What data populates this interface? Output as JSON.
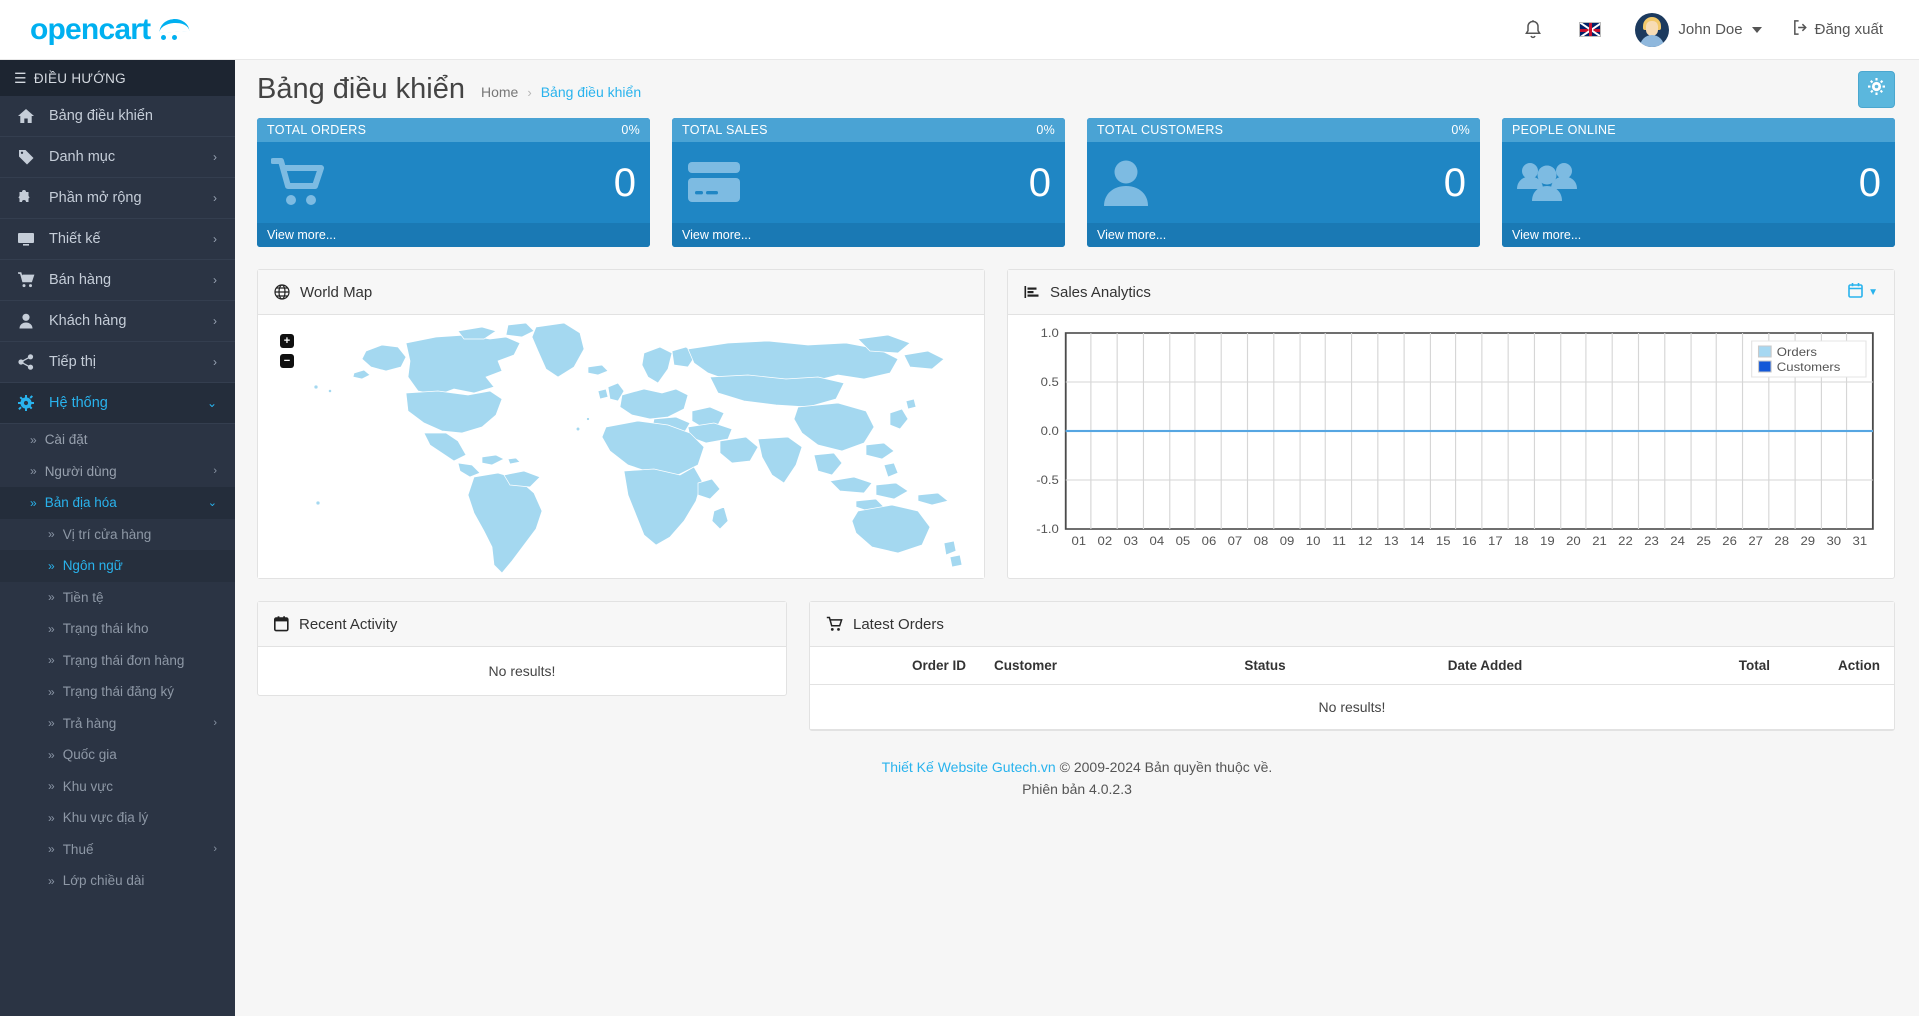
{
  "header": {
    "logo_text": "opencart",
    "bell_icon": "bell-icon",
    "language_flag": "uk-flag-icon",
    "user_name": "John Doe",
    "logout_label": "Đăng xuất"
  },
  "sidebar": {
    "nav_header": "ĐIỀU HƯỚNG",
    "items": [
      {
        "label": "Bảng điều khiển",
        "icon": "home-icon",
        "arrow": "",
        "state": ""
      },
      {
        "label": "Danh mục",
        "icon": "tag-icon",
        "arrow": "›",
        "state": ""
      },
      {
        "label": "Phần mở rộng",
        "icon": "puzzle-icon",
        "arrow": "›",
        "state": ""
      },
      {
        "label": "Thiết kế",
        "icon": "monitor-icon",
        "arrow": "›",
        "state": ""
      },
      {
        "label": "Bán hàng",
        "icon": "cart-icon",
        "arrow": "›",
        "state": ""
      },
      {
        "label": "Khách hàng",
        "icon": "user-icon",
        "arrow": "›",
        "state": ""
      },
      {
        "label": "Tiếp thị",
        "icon": "share-icon",
        "arrow": "›",
        "state": ""
      },
      {
        "label": "Hệ thống",
        "icon": "gear-icon",
        "arrow": "⌄",
        "state": "active"
      }
    ],
    "system_children": [
      {
        "label": "Cài đặt",
        "arrow": "",
        "state": ""
      },
      {
        "label": "Người dùng",
        "arrow": "›",
        "state": ""
      },
      {
        "label": "Bản địa hóa",
        "arrow": "⌄",
        "state": "open"
      }
    ],
    "localisation_children": [
      {
        "label": "Vị trí cửa hàng",
        "arrow": "",
        "state": ""
      },
      {
        "label": "Ngôn ngữ",
        "arrow": "",
        "state": "active"
      },
      {
        "label": "Tiền tệ",
        "arrow": "",
        "state": ""
      },
      {
        "label": "Trạng thái kho",
        "arrow": "",
        "state": ""
      },
      {
        "label": "Trạng thái đơn hàng",
        "arrow": "",
        "state": ""
      },
      {
        "label": "Trạng thái đăng ký",
        "arrow": "",
        "state": ""
      },
      {
        "label": "Trả hàng",
        "arrow": "›",
        "state": ""
      },
      {
        "label": "Quốc gia",
        "arrow": "",
        "state": ""
      },
      {
        "label": "Khu vực",
        "arrow": "",
        "state": ""
      },
      {
        "label": "Khu vực địa lý",
        "arrow": "",
        "state": ""
      },
      {
        "label": "Thuế",
        "arrow": "›",
        "state": ""
      },
      {
        "label": "Lớp chiều dài",
        "arrow": "",
        "state": ""
      }
    ]
  },
  "page": {
    "title": "Bảng điều khiển",
    "breadcrumb_home": "Home",
    "breadcrumb_sep": "›",
    "breadcrumb_current": "Bảng điều khiển",
    "settings_icon": "gear-icon"
  },
  "stat_cards": [
    {
      "title": "TOTAL ORDERS",
      "percent": "0%",
      "value": "0",
      "footer": "View more...",
      "icon": "shopping-cart-icon"
    },
    {
      "title": "TOTAL SALES",
      "percent": "0%",
      "value": "0",
      "footer": "View more...",
      "icon": "credit-card-icon"
    },
    {
      "title": "TOTAL CUSTOMERS",
      "percent": "0%",
      "value": "0",
      "footer": "View more...",
      "icon": "person-icon"
    },
    {
      "title": "PEOPLE ONLINE",
      "percent": "",
      "value": "0",
      "footer": "View more...",
      "icon": "people-group-icon"
    }
  ],
  "world_map": {
    "title": "World Map",
    "icon": "globe-icon",
    "zoom_in": "+",
    "zoom_out": "−"
  },
  "analytics": {
    "title": "Sales Analytics",
    "icon": "bar-chart-icon",
    "range_icon": "calendar-icon",
    "range_caret": "▼"
  },
  "chart_data": {
    "type": "line",
    "title": "Sales Analytics",
    "xlabel": "",
    "ylabel": "",
    "x": [
      "01",
      "02",
      "03",
      "04",
      "05",
      "06",
      "07",
      "08",
      "09",
      "10",
      "11",
      "12",
      "13",
      "14",
      "15",
      "16",
      "17",
      "18",
      "19",
      "20",
      "21",
      "22",
      "23",
      "24",
      "25",
      "26",
      "27",
      "28",
      "29",
      "30",
      "31"
    ],
    "ytick_labels": [
      "1.0",
      "0.5",
      "0.0",
      "-0.5",
      "-1.0"
    ],
    "ylim": [
      -1.0,
      1.0
    ],
    "grid": true,
    "legend_position": "top-right",
    "series": [
      {
        "name": "Orders",
        "color": "#a6d8f2",
        "values": [
          0,
          0,
          0,
          0,
          0,
          0,
          0,
          0,
          0,
          0,
          0,
          0,
          0,
          0,
          0,
          0,
          0,
          0,
          0,
          0,
          0,
          0,
          0,
          0,
          0,
          0,
          0,
          0,
          0,
          0,
          0
        ]
      },
      {
        "name": "Customers",
        "color": "#1358d8",
        "values": [
          0,
          0,
          0,
          0,
          0,
          0,
          0,
          0,
          0,
          0,
          0,
          0,
          0,
          0,
          0,
          0,
          0,
          0,
          0,
          0,
          0,
          0,
          0,
          0,
          0,
          0,
          0,
          0,
          0,
          0,
          0
        ]
      }
    ]
  },
  "recent_activity": {
    "title": "Recent Activity",
    "icon": "calendar-icon",
    "empty_text": "No results!"
  },
  "latest_orders": {
    "title": "Latest Orders",
    "icon": "shopping-cart-icon",
    "columns": [
      "Order ID",
      "Customer",
      "Status",
      "Date Added",
      "Total",
      "Action"
    ],
    "empty_text": "No results!",
    "rows": []
  },
  "footer": {
    "link_text": "Thiết Kế Website Gutech.vn",
    "copyright": " © 2009-2024 Bản quyền thuộc về.",
    "version": "Phiên bản 4.0.2.3"
  },
  "colors": {
    "brand": "#00b0f0",
    "accent": "#29b3ed",
    "card_blue": "#1f86c4",
    "sidebar": "#2b3444",
    "map_fill": "#a4d8f0"
  }
}
